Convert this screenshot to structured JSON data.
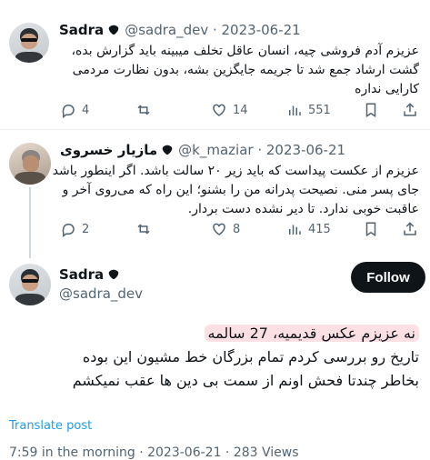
{
  "tweet1": {
    "name": "Sadra",
    "handle": "@sadra_dev",
    "date": "2023-06-21",
    "lines": [
      "عزیزم آدم فروشی چیه، انسان عاقل تخلف میبینه باید گزارش بده،",
      "گشت ارشاد جمع شد تا جریمه جایگزین بشه، بدون نظارت مردمی",
      "کارایی نداره"
    ],
    "replies": "4",
    "retweets": "",
    "likes": "14",
    "views": "551"
  },
  "tweet2": {
    "name": "مازیار خسروی",
    "handle": "@k_maziar",
    "date": "2023-06-21",
    "lines": [
      "عزیزم از عکست پیداست که باید زیر ۲۰ سالت باشد. اگر اینطور باشد",
      "جای پسر منی. نصیحت پدرانه من را بشنو؛ این راه که می‌روی آخر و",
      "عاقبت خوبی ندارد. تا دیر نشده دست بردار."
    ],
    "replies": "2",
    "retweets": "",
    "likes": "8",
    "views": "415"
  },
  "tweet3": {
    "name": "Sadra",
    "handle": "@sadra_dev",
    "follow_label": "Follow",
    "line1_highlight": "نه عزیزم عکس قدیمیه، 27 سالمه",
    "line2": "تاریخ رو بررسی کردم تمام بزرگان خط مشیون این بوده",
    "line3": "بخاطر چندتا فحش اونم از سمت بی دین ها عقب نمیکشم",
    "translate": "Translate post",
    "footer": "7:59 in the morning · 2023-06-21 · 283 Views"
  },
  "colors": {
    "accent": "#1d9bf0",
    "highlight": "#fde0e3",
    "muted": "#536471"
  }
}
